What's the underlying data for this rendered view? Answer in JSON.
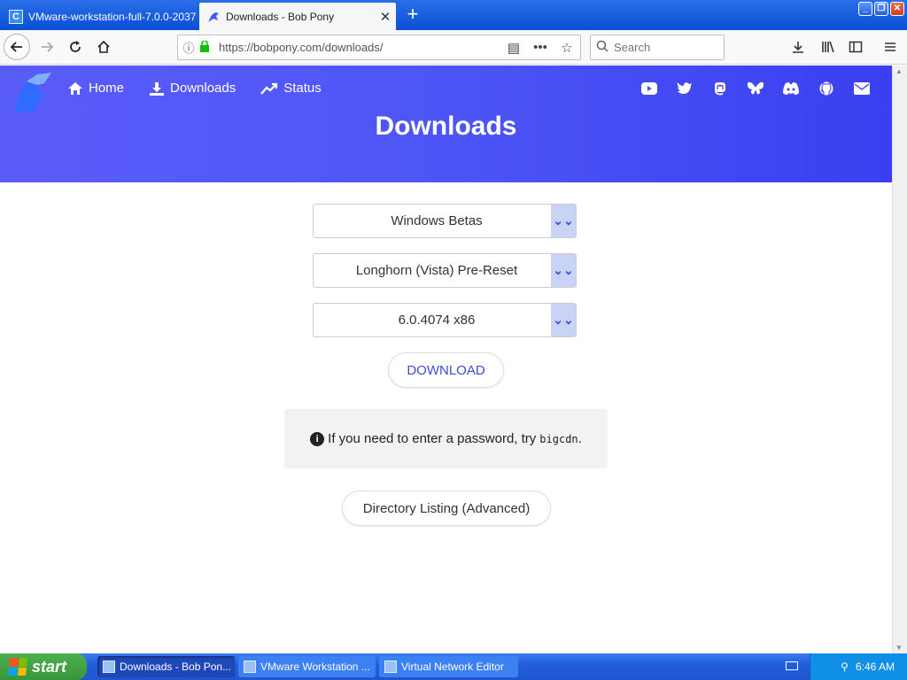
{
  "browser": {
    "tabs": [
      {
        "title": "VMware-workstation-full-7.0.0-2037",
        "active": false
      },
      {
        "title": "Downloads - Bob Pony",
        "active": true
      }
    ],
    "url": "https://bobpony.com/downloads/",
    "search_placeholder": "Search"
  },
  "site": {
    "nav": [
      {
        "label": "Home",
        "icon": "home-icon"
      },
      {
        "label": "Downloads",
        "icon": "download-icon"
      },
      {
        "label": "Status",
        "icon": "trend-icon"
      }
    ],
    "social_icons": [
      "youtube-icon",
      "twitter-icon",
      "mastodon-icon",
      "bluesky-icon",
      "discord-icon",
      "github-icon",
      "email-icon"
    ],
    "title": "Downloads"
  },
  "form": {
    "category": "Windows Betas",
    "product": "Longhorn (Vista) Pre-Reset",
    "build": "6.0.4074 x86",
    "download_label": "DOWNLOAD",
    "notice_text": "If you need to enter a password, try",
    "password": "bigcdn",
    "directory_label": "Directory Listing (Advanced)"
  },
  "taskbar": {
    "start_label": "start",
    "tasks": [
      {
        "label": "Downloads - Bob Pon...",
        "active": true
      },
      {
        "label": "VMware Workstation ...",
        "active": false
      },
      {
        "label": "Virtual Network Editor",
        "active": false
      }
    ],
    "clock": "6:46 AM"
  },
  "colors": {
    "hero": "#4e55f6",
    "accent": "#3b4ed8",
    "taskbar": "#245edc",
    "start": "#37953a"
  }
}
